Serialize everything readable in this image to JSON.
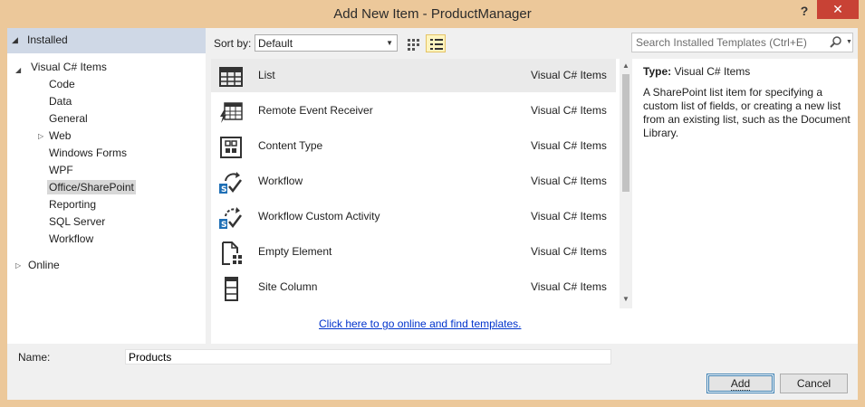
{
  "window": {
    "title": "Add New Item - ProductManager",
    "help_label": "?",
    "close_label": "✕"
  },
  "tree": {
    "header_label": "Installed",
    "items": [
      {
        "label": "Visual C# Items",
        "level": 1,
        "expanded": true
      },
      {
        "label": "Code",
        "level": 2
      },
      {
        "label": "Data",
        "level": 2
      },
      {
        "label": "General",
        "level": 2
      },
      {
        "label": "Web",
        "level": 2,
        "collapsed": true
      },
      {
        "label": "Windows Forms",
        "level": 2
      },
      {
        "label": "WPF",
        "level": 2
      },
      {
        "label": "Office/SharePoint",
        "level": 2,
        "selected": true
      },
      {
        "label": "Reporting",
        "level": 2
      },
      {
        "label": "SQL Server",
        "level": 2
      },
      {
        "label": "Workflow",
        "level": 2
      },
      {
        "label": "Online",
        "level": 0,
        "collapsed": true
      }
    ]
  },
  "toolbar": {
    "sort_label": "Sort by:",
    "sort_value": "Default",
    "view_modes": [
      "medium-icons-view",
      "list-view"
    ],
    "active_view": "list-view",
    "search_placeholder": "Search Installed Templates (Ctrl+E)"
  },
  "templates": [
    {
      "name": "List",
      "category": "Visual C# Items",
      "icon": "list-icon",
      "selected": true
    },
    {
      "name": "Remote Event Receiver",
      "category": "Visual C# Items",
      "icon": "remote-event-receiver-icon"
    },
    {
      "name": "Content Type",
      "category": "Visual C# Items",
      "icon": "content-type-icon"
    },
    {
      "name": "Workflow",
      "category": "Visual C# Items",
      "icon": "workflow-icon"
    },
    {
      "name": "Workflow Custom Activity",
      "category": "Visual C# Items",
      "icon": "workflow-custom-activity-icon"
    },
    {
      "name": "Empty Element",
      "category": "Visual C# Items",
      "icon": "empty-element-icon"
    },
    {
      "name": "Site Column",
      "category": "Visual C# Items",
      "icon": "site-column-icon"
    }
  ],
  "online_link": "Click here to go online and find templates.",
  "details": {
    "type_label": "Type:",
    "type_value": "Visual C# Items",
    "description": "A SharePoint list item for specifying a custom list of fields, or creating a new list from an existing list, such as the Document Library."
  },
  "footer": {
    "name_label": "Name:",
    "name_value": "Products",
    "add_label": "Add",
    "cancel_label": "Cancel"
  },
  "colors": {
    "title_bar": "#ecc89a",
    "close_button": "#c84235",
    "tree_header": "#cfd8e6",
    "link": "#0033cc"
  }
}
